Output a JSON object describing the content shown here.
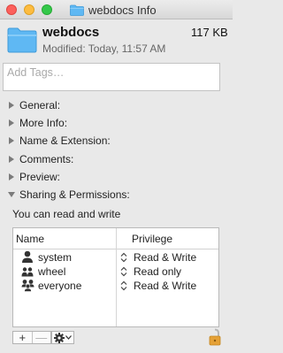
{
  "window": {
    "title": "webdocs Info"
  },
  "file": {
    "name": "webdocs",
    "size": "117 KB",
    "modified": "Modified: Today, 11:57 AM"
  },
  "tags": {
    "placeholder": "Add Tags…"
  },
  "sections": [
    {
      "label": "General:",
      "expanded": false
    },
    {
      "label": "More Info:",
      "expanded": false
    },
    {
      "label": "Name & Extension:",
      "expanded": false
    },
    {
      "label": "Comments:",
      "expanded": false
    },
    {
      "label": "Preview:",
      "expanded": false
    },
    {
      "label": "Sharing & Permissions:",
      "expanded": true
    }
  ],
  "permissions": {
    "summary": "You can read and write",
    "headers": {
      "name": "Name",
      "privilege": "Privilege"
    },
    "rows": [
      {
        "name": "system",
        "privilege": "Read & Write",
        "icon": "single-user-icon"
      },
      {
        "name": "wheel",
        "privilege": "Read only",
        "icon": "group-icon"
      },
      {
        "name": "everyone",
        "privilege": "Read & Write",
        "icon": "everyone-icon"
      }
    ]
  },
  "buttons": {
    "add": "+",
    "remove": "—"
  },
  "colors": {
    "folder_blue": "#5fb8f3",
    "lock_orange": "#e5a137",
    "window_bg": "#e9e9e9"
  }
}
